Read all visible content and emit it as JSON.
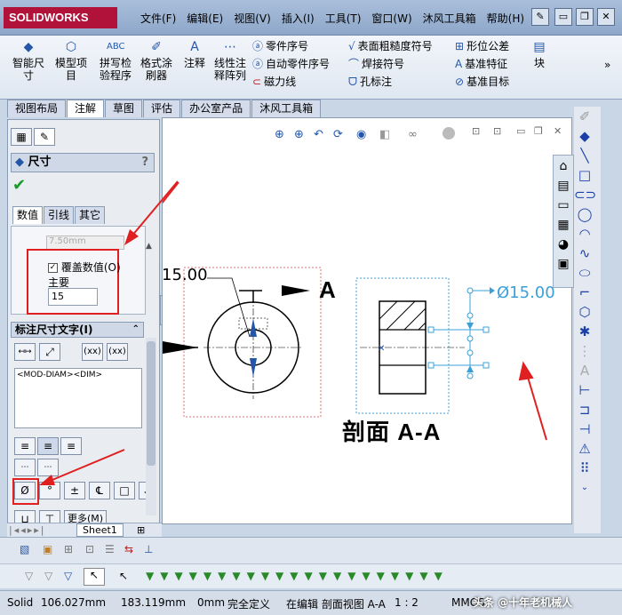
{
  "app": {
    "logo": "SOLIDWORKS"
  },
  "menu": [
    "文件(F)",
    "编辑(E)",
    "视图(V)",
    "插入(I)",
    "工具(T)",
    "窗口(W)",
    "沐风工具箱",
    "帮助(H)"
  ],
  "ribbon": {
    "smart_dim": "智能尺\n寸",
    "model_items": "模型项\n目",
    "spell": "拼写检\n验程序",
    "format_painter": "格式涂\n刷器",
    "note": "注释",
    "linear_pattern": "线性注\n释阵列",
    "balloon": "零件序号",
    "auto_balloon": "自动零件序号",
    "magnetic_line": "磁力线",
    "surface_finish": "表面粗糙度符号",
    "weld_symbol": "焊接符号",
    "hole_callout": "孔标注",
    "gtol": "形位公差",
    "datum_feature": "基准特征",
    "datum_target": "基准目标",
    "block": "块"
  },
  "tabs": [
    "视图布局",
    "注解",
    "草图",
    "评估",
    "办公室产品",
    "沐风工具箱"
  ],
  "active_tab": 1,
  "property_manager": {
    "title": "尺寸",
    "help": "?",
    "subtabs": [
      "数值",
      "引线",
      "其它"
    ],
    "faded_value": "7.50mm",
    "override_label": "覆盖数值(O)",
    "override_checked": true,
    "primary_label": "主要",
    "primary_value": "15",
    "dim_text_header": "标注尺寸文字(I)",
    "dim_text_value": "<MOD-DIAM><DIM>",
    "more_button": "更多(M)"
  },
  "sheet_tab": "Sheet1",
  "drawing": {
    "dim_left": "15.00",
    "section_label_a": "A",
    "dim_right": "Ø15.00",
    "section_title": "剖面 A-A"
  },
  "status": {
    "app_short": "Solid",
    "x": "106.027mm",
    "y": "183.119mm",
    "z": "0mm",
    "state": "完全定义",
    "editing": "在编辑 剖面视图 A-A",
    "scale": "1 : 2",
    "units": "MMGS",
    "watermark": "头条 @十年老机械人"
  },
  "colors": {
    "accent_red": "#e02020",
    "solidworks_red": "#b0123a",
    "dim_blue": "#3aa0d8",
    "ui_blue": "#2456a8"
  }
}
